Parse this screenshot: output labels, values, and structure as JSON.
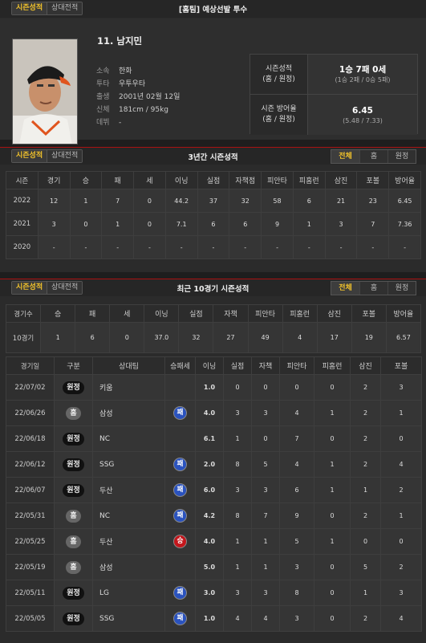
{
  "top_bar": {
    "tab_active": "시즌성적",
    "tab_other": "상대전적",
    "title": "[홈팀] 예상선발 투수"
  },
  "profile": {
    "name": "11. 남지민",
    "team_label": "소속",
    "team": "한화",
    "throw_label": "투타",
    "throw": "우투우타",
    "birth_label": "출생",
    "birth": "2001년 02월 12일",
    "body_label": "신체",
    "body": "181cm / 95kg",
    "debut_label": "데뷔",
    "debut": "-"
  },
  "season_box": {
    "record_label1": "시즌성적",
    "record_label2": "(홈 / 원정)",
    "record_main": "1승 7패 0세",
    "record_sub": "(1승 2패 / 0승 5패)",
    "era_label1": "시즌 방어율",
    "era_label2": "(홈 / 원정)",
    "era_main": "6.45",
    "era_sub": "(5.48 / 7.33)"
  },
  "three_year": {
    "tab_active": "시즌성적",
    "tab_other": "상대전적",
    "title": "3년간 시즌성적",
    "filters": [
      "전체",
      "홈",
      "원정"
    ],
    "headers": [
      "시즌",
      "경기",
      "승",
      "패",
      "세",
      "이닝",
      "실점",
      "자책점",
      "피안타",
      "피홈런",
      "삼진",
      "포볼",
      "방어율"
    ],
    "rows": [
      [
        "2022",
        "12",
        "1",
        "7",
        "0",
        "44.2",
        "37",
        "32",
        "58",
        "6",
        "21",
        "23",
        "6.45"
      ],
      [
        "2021",
        "3",
        "0",
        "1",
        "0",
        "7.1",
        "6",
        "6",
        "9",
        "1",
        "3",
        "7",
        "7.36"
      ],
      [
        "2020",
        "-",
        "-",
        "-",
        "-",
        "-",
        "-",
        "-",
        "-",
        "-",
        "-",
        "-",
        "-"
      ]
    ]
  },
  "recent": {
    "tab_active": "시즌성적",
    "tab_other": "상대전적",
    "title": "최근 10경기 시즌성적",
    "filters": [
      "전체",
      "홈",
      "원정"
    ],
    "summary_headers": [
      "경기수",
      "승",
      "패",
      "세",
      "이닝",
      "실점",
      "자책",
      "피안타",
      "피홈런",
      "삼진",
      "포볼",
      "방어율"
    ],
    "summary_row": [
      "10경기",
      "1",
      "6",
      "0",
      "37.0",
      "32",
      "27",
      "49",
      "4",
      "17",
      "19",
      "6.57"
    ],
    "game_headers": [
      "경기일",
      "구분",
      "상대팀",
      "승패세",
      "이닝",
      "실점",
      "자책",
      "피안타",
      "피홈런",
      "삼진",
      "포볼"
    ],
    "games": [
      {
        "date": "22/07/02",
        "type": "원정",
        "home": false,
        "opp": "키움",
        "dec": "",
        "ip": "1.0",
        "r": "0",
        "er": "0",
        "h": "0",
        "hr": "0",
        "so": "2",
        "bb": "3"
      },
      {
        "date": "22/06/26",
        "type": "홈",
        "home": true,
        "opp": "삼성",
        "dec": "패",
        "ip": "4.0",
        "r": "3",
        "er": "3",
        "h": "4",
        "hr": "1",
        "so": "2",
        "bb": "1"
      },
      {
        "date": "22/06/18",
        "type": "원정",
        "home": false,
        "opp": "NC",
        "dec": "",
        "ip": "6.1",
        "r": "1",
        "er": "0",
        "h": "7",
        "hr": "0",
        "so": "2",
        "bb": "0"
      },
      {
        "date": "22/06/12",
        "type": "원정",
        "home": false,
        "opp": "SSG",
        "dec": "패",
        "ip": "2.0",
        "r": "8",
        "er": "5",
        "h": "4",
        "hr": "1",
        "so": "2",
        "bb": "4"
      },
      {
        "date": "22/06/07",
        "type": "원정",
        "home": false,
        "opp": "두산",
        "dec": "패",
        "ip": "6.0",
        "r": "3",
        "er": "3",
        "h": "6",
        "hr": "1",
        "so": "1",
        "bb": "2"
      },
      {
        "date": "22/05/31",
        "type": "홈",
        "home": true,
        "opp": "NC",
        "dec": "패",
        "ip": "4.2",
        "r": "8",
        "er": "7",
        "h": "9",
        "hr": "0",
        "so": "2",
        "bb": "1"
      },
      {
        "date": "22/05/25",
        "type": "홈",
        "home": true,
        "opp": "두산",
        "dec": "승",
        "ip": "4.0",
        "r": "1",
        "er": "1",
        "h": "5",
        "hr": "1",
        "so": "0",
        "bb": "0"
      },
      {
        "date": "22/05/19",
        "type": "홈",
        "home": true,
        "opp": "삼성",
        "dec": "",
        "ip": "5.0",
        "r": "1",
        "er": "1",
        "h": "3",
        "hr": "0",
        "so": "5",
        "bb": "2"
      },
      {
        "date": "22/05/11",
        "type": "원정",
        "home": false,
        "opp": "LG",
        "dec": "패",
        "ip": "3.0",
        "r": "3",
        "er": "3",
        "h": "8",
        "hr": "0",
        "so": "1",
        "bb": "3"
      },
      {
        "date": "22/05/05",
        "type": "원정",
        "home": false,
        "opp": "SSG",
        "dec": "패",
        "ip": "1.0",
        "r": "4",
        "er": "4",
        "h": "3",
        "hr": "0",
        "so": "2",
        "bb": "4"
      }
    ]
  }
}
